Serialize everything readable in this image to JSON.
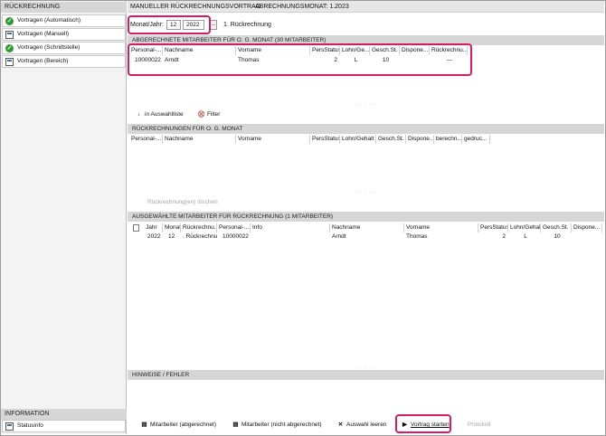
{
  "sidebar": {
    "section1_title": "RÜCKRECHNUNG",
    "items": [
      {
        "label": "Vortragen (Automatisch)",
        "icon": "check-circle-icon"
      },
      {
        "label": "Vortragen (Manuell)",
        "icon": "document-icon"
      },
      {
        "label": "Vortragen (Schnittstelle)",
        "icon": "check-circle-icon"
      },
      {
        "label": "Vortragen (Bereich)",
        "icon": "document-icon"
      }
    ],
    "section2_title": "INFORMATION",
    "info_items": [
      {
        "label": "Statusinfo",
        "icon": "document-icon"
      }
    ]
  },
  "header": {
    "title": "MANUELLER RÜCKRECHNUNGSVORTRAG",
    "month": "ABRECHNUNGSMONAT: 1.2023"
  },
  "period": {
    "label": "Monat/Jahr:",
    "month": "12",
    "year": "2022",
    "dots": "...",
    "info": "1. Rückrechnung"
  },
  "billed": {
    "title": "ABGERECHNETE MITARBEITER FÜR O. G. MONAT (30 MITARBEITER)",
    "columns": [
      "Personal-...",
      "Nachname",
      "Vorname",
      "PersStatus",
      "Lohn/Ge...",
      "Gesch.St.",
      "Dispone...",
      "Rückrechnu..."
    ],
    "rows": [
      {
        "pers": "10000022",
        "nachname": "Arndt",
        "vorname": "Thomas",
        "status": "2",
        "lohn": "L",
        "gesch": "10",
        "dispo": "",
        "rueck": "—"
      }
    ]
  },
  "billed_toolbar": {
    "move": "in Auswahlliste",
    "filter": "Filter"
  },
  "recalc": {
    "title": "RÜCKRECHNUNGEN FÜR O. G. MONAT",
    "columns": [
      "Personal-...",
      "Nachname",
      "Vorname",
      "PersStatus",
      "Lohn/Gehalt",
      "Gesch.St.",
      "Dispone...",
      "berechn...",
      "gedruc..."
    ],
    "delete_button": "Rückrechnung(en) löschen"
  },
  "selected": {
    "title": "AUSGEWÄHLTE MITARBEITER FÜR RÜCKRECHNUNG (1 MITARBEITER)",
    "columns": [
      "Jahr",
      "Monat",
      "Rückrechnu...",
      "Personal-...",
      "Info",
      "Nachname",
      "Vorname",
      "PersStatus",
      "Lohn/Gehalt",
      "Gesch.St.",
      "Dispone..."
    ],
    "rows": [
      {
        "jahr": "2022",
        "monat": "12",
        "rueck": ". Rückrechnun",
        "pers": "10000022",
        "info": "",
        "nachname": "Arndt",
        "vorname": "Thomas",
        "status": "2",
        "lohn": "L",
        "gesch": "10",
        "dispo": ""
      }
    ]
  },
  "hints": {
    "title": "HINWEISE / FEHLER"
  },
  "footer": {
    "btn1": "Mitarbeiter (abgerechnet)",
    "btn2": "Mitarbeiter (nicht abgerechnet)",
    "btn3": "Auswahl leeren",
    "btn4": "Vortrag starten",
    "btn5": "Protokoll"
  },
  "colors": {
    "highlight": "#d81b60",
    "header_bg": "#d6d6d6",
    "check_green": "#2e9a2e"
  }
}
